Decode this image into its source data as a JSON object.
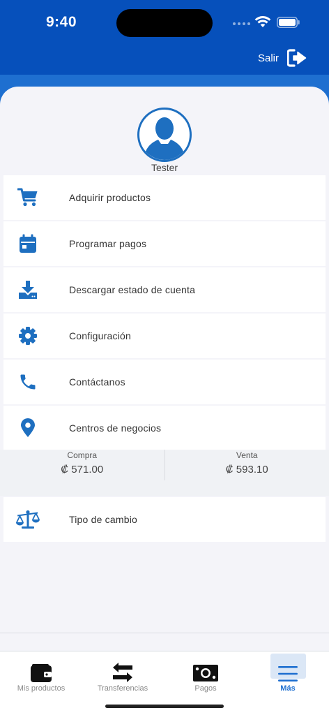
{
  "status": {
    "time": "9:40"
  },
  "header": {
    "logout_label": "Salir"
  },
  "profile": {
    "name": "Tester"
  },
  "menu": {
    "items": [
      {
        "label": "Adquirir productos",
        "icon": "cart-icon"
      },
      {
        "label": "Programar pagos",
        "icon": "calendar-icon"
      },
      {
        "label": "Descargar estado de cuenta",
        "icon": "download-icon"
      },
      {
        "label": "Configuración",
        "icon": "gear-icon"
      },
      {
        "label": "Contáctanos",
        "icon": "phone-icon"
      },
      {
        "label": "Centros de negocios",
        "icon": "location-pin-icon"
      }
    ]
  },
  "rates": {
    "buy_label": "Compra",
    "buy_value": "₡ 571.00",
    "sell_label": "Venta",
    "sell_value": "₡ 593.10"
  },
  "exchange": {
    "label": "Tipo de cambio",
    "icon": "scale-icon"
  },
  "tabbar": {
    "tabs": [
      {
        "label": "Mis productos",
        "icon": "wallet-icon"
      },
      {
        "label": "Transferencias",
        "icon": "transfer-arrows-icon"
      },
      {
        "label": "Pagos",
        "icon": "money-icon"
      },
      {
        "label": "Más",
        "icon": "menu-icon"
      }
    ],
    "active": "Más"
  },
  "colors": {
    "primary": "#0650bb",
    "accent": "#1e6fd0",
    "icon": "#1e6fc0"
  }
}
